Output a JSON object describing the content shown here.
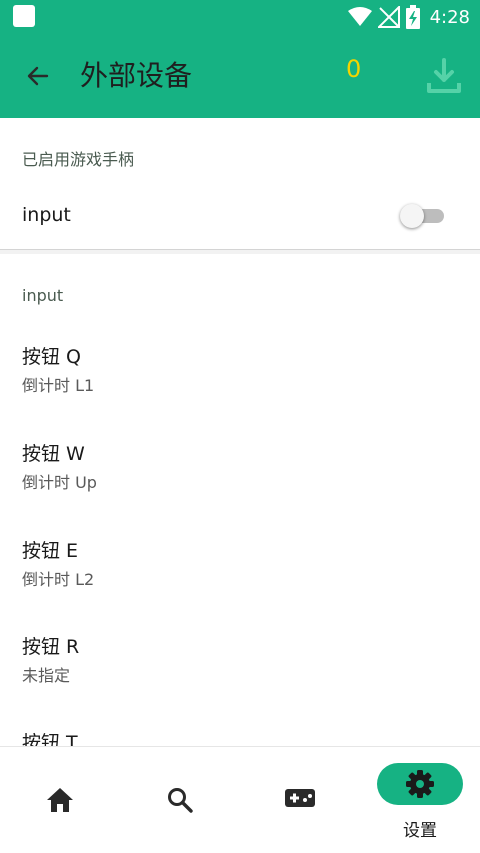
{
  "status_bar": {
    "time": "4:28"
  },
  "app_bar": {
    "title": "外部设备",
    "count": "0"
  },
  "gamepad_section": {
    "header": "已启用游戏手柄",
    "toggle_label": "input",
    "toggle_on": false
  },
  "input_section": {
    "header": "input",
    "items": [
      {
        "title": "按钮 Q",
        "subtitle": "倒计时 L1"
      },
      {
        "title": "按钮 W",
        "subtitle": "倒计时 Up"
      },
      {
        "title": "按钮 E",
        "subtitle": "倒计时 L2"
      },
      {
        "title": "按钮 R",
        "subtitle": "未指定"
      },
      {
        "title": "按钮 T",
        "subtitle": ""
      }
    ]
  },
  "bottom_nav": {
    "items": [
      {
        "icon": "home-icon",
        "label": ""
      },
      {
        "icon": "search-icon",
        "label": ""
      },
      {
        "icon": "gamepad-icon",
        "label": ""
      },
      {
        "icon": "gear-icon",
        "label": "设置",
        "active": true
      }
    ]
  },
  "colors": {
    "primary": "#16b283",
    "count": "#f5d400"
  }
}
